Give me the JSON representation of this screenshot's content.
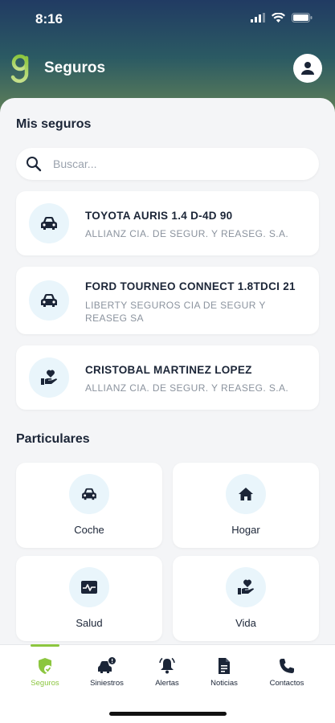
{
  "status_bar": {
    "time": "8:16"
  },
  "app": {
    "title": "Seguros"
  },
  "mis_seguros": {
    "title": "Mis seguros",
    "search": {
      "placeholder": "Buscar...",
      "value": ""
    },
    "policies": [
      {
        "name": "TOYOTA AURIS 1.4 D-4D 90",
        "insurer": "ALLIANZ CIA. DE SEGUR. Y REASEG. S.A.",
        "icon": "car-icon"
      },
      {
        "name": "FORD TOURNEO CONNECT 1.8TDCI 21",
        "insurer": "LIBERTY SEGUROS CIA DE SEGUR Y REASEG SA",
        "icon": "car-icon"
      },
      {
        "name": "CRISTOBAL MARTINEZ LOPEZ",
        "insurer": "ALLIANZ CIA. DE SEGUR. Y REASEG. S.A.",
        "icon": "hand-heart-icon"
      }
    ]
  },
  "particulares": {
    "title": "Particulares",
    "tiles": [
      {
        "label": "Coche",
        "icon": "car-icon"
      },
      {
        "label": "Hogar",
        "icon": "home-icon"
      },
      {
        "label": "Salud",
        "icon": "heartbeat-icon"
      },
      {
        "label": "Vida",
        "icon": "hand-heart-icon"
      }
    ]
  },
  "bottom_nav": {
    "items": [
      {
        "label": "Seguros",
        "icon": "shield-icon",
        "active": true
      },
      {
        "label": "Siniestros",
        "icon": "car-accident-icon",
        "active": false
      },
      {
        "label": "Alertas",
        "icon": "bell-icon",
        "active": false
      },
      {
        "label": "Noticias",
        "icon": "document-icon",
        "active": false
      },
      {
        "label": "Contactos",
        "icon": "phone-icon",
        "active": false
      }
    ]
  },
  "colors": {
    "accent_green": "#8cc63f",
    "navy": "#1b2537",
    "icon_bg": "#e9f5fb",
    "header_top": "#213b63"
  }
}
